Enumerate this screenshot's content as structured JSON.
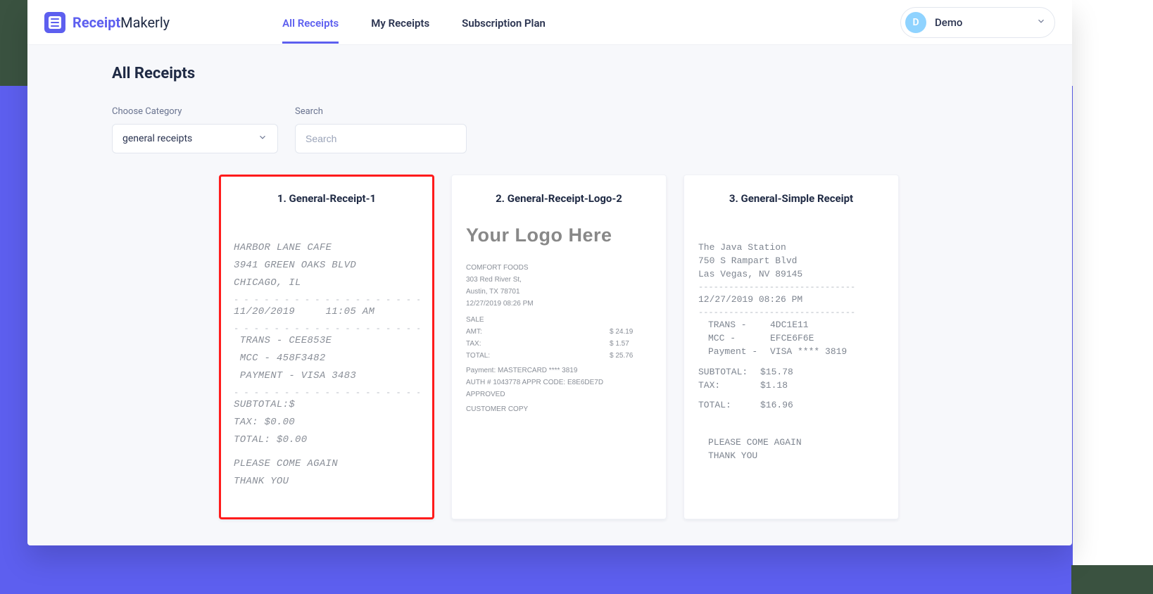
{
  "brand": {
    "part1": "Receipt",
    "part2": "Makerly"
  },
  "nav": {
    "items": [
      "All Receipts",
      "My Receipts",
      "Subscription Plan"
    ],
    "active_index": 0
  },
  "user": {
    "initial": "D",
    "name": "Demo"
  },
  "page": {
    "title": "All Receipts",
    "filters": {
      "category_label": "Choose Category",
      "category_value": "general receipts",
      "search_label": "Search",
      "search_placeholder": "Search"
    }
  },
  "cards": [
    {
      "title": "1. General-Receipt-1",
      "selected": true,
      "receipt1": {
        "store": "HARBOR LANE CAFE",
        "addr1": "3941 GREEN OAKS BLVD",
        "addr2": "CHICAGO, IL",
        "date": "11/20/2019",
        "time": "11:05 AM",
        "trans": "TRANS - CEE853E",
        "mcc": "MCC - 458F3482",
        "payment": "PAYMENT - VISA 3483",
        "subtotal": "SUBTOTAL:$",
        "tax": "TAX:   $0.00",
        "total": "TOTAL: $0.00",
        "msg1": "PLEASE COME AGAIN",
        "msg2": "THANK YOU"
      }
    },
    {
      "title": "2. General-Receipt-Logo-2",
      "receipt2": {
        "logo": "Your Logo Here",
        "store": "COMFORT FOODS",
        "addr1": "303 Red River St,",
        "addr2": "Austin, TX 78701",
        "datetime": "12/27/2019     08:26 PM",
        "sale": "SALE",
        "amt_label": "AMT:",
        "amt": "$ 24.19",
        "tax_label": "TAX:",
        "tax": "$ 1.57",
        "total_label": "TOTAL:",
        "total": "$ 25.76",
        "payment": "Payment: MASTERCARD **** 3819",
        "auth": "AUTH # 1043778    APPR CODE: E8E6DE7D",
        "approved": "APPROVED",
        "copy": "CUSTOMER COPY"
      }
    },
    {
      "title": "3. General-Simple Receipt",
      "receipt3": {
        "store": "The Java Station",
        "addr1": "750 S Rampart Blvd",
        "addr2": "Las Vegas, NV 89145",
        "datetime": "12/27/2019 08:26 PM",
        "trans_label": "TRANS -",
        "trans": "4DC1E11",
        "mcc_label": "MCC -",
        "mcc": "EFCE6F6E",
        "pay_label": "Payment -",
        "pay": "VISA **** 3819",
        "subtotal_label": "SUBTOTAL:",
        "subtotal": "$15.78",
        "tax_label": "TAX:",
        "tax": "$1.18",
        "total_label": "TOTAL:",
        "total": "$16.96",
        "msg1": "PLEASE COME AGAIN",
        "msg2": "THANK YOU"
      }
    }
  ],
  "dash": "- - - - - - - - - - - - - - - - - - - - - - - - -",
  "dash3": "-------------------------------"
}
